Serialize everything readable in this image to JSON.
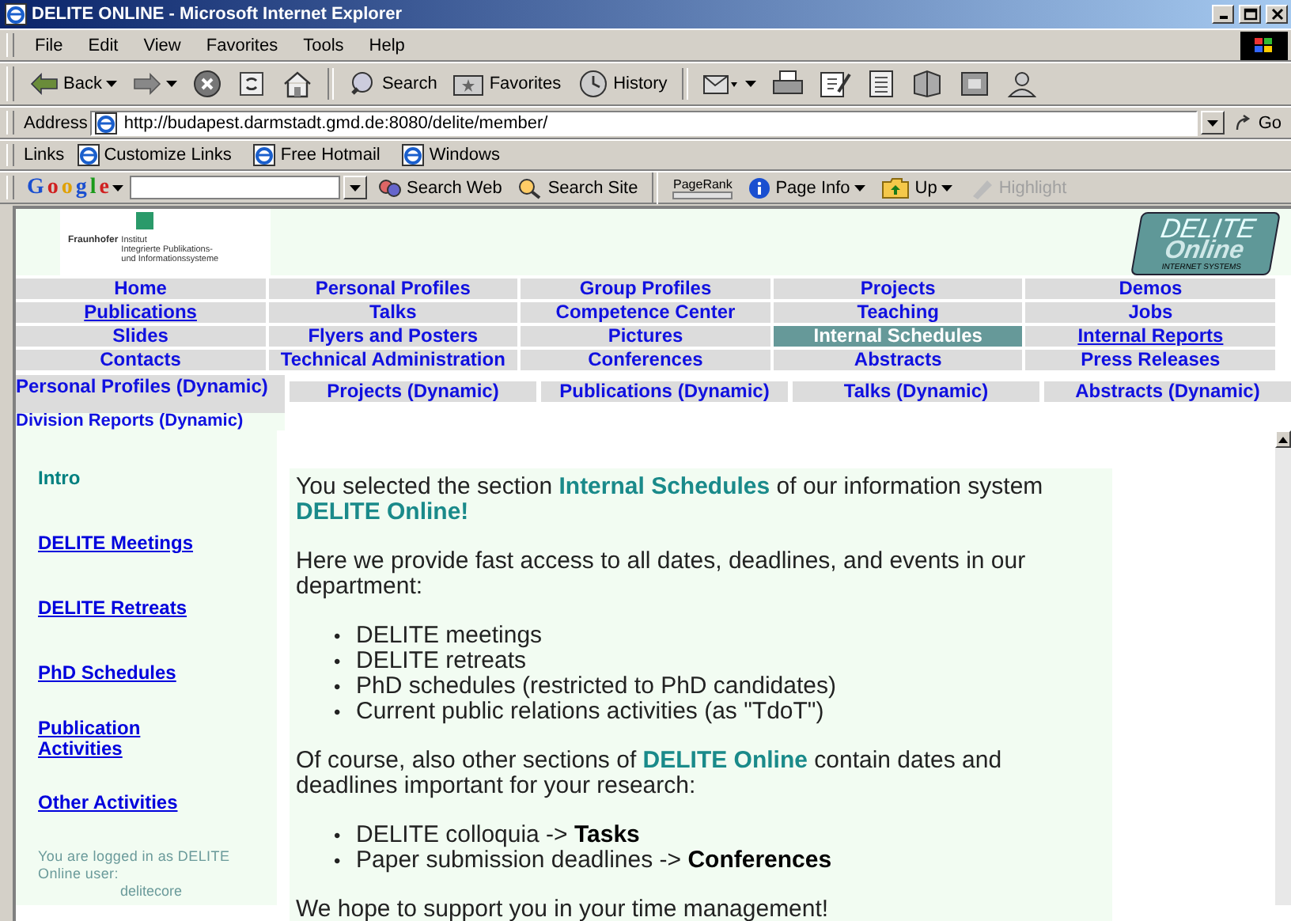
{
  "window": {
    "title": "DELITE ONLINE - Microsoft Internet Explorer"
  },
  "menu": [
    "File",
    "Edit",
    "View",
    "Favorites",
    "Tools",
    "Help"
  ],
  "toolbar": [
    {
      "kind": "back",
      "label": "Back"
    },
    {
      "kind": "forward"
    },
    {
      "kind": "stop"
    },
    {
      "kind": "refresh"
    },
    {
      "kind": "home"
    },
    {
      "kind": "search",
      "label": "Search"
    },
    {
      "kind": "favorites",
      "label": "Favorites"
    },
    {
      "kind": "history",
      "label": "History"
    },
    {
      "kind": "mail"
    },
    {
      "kind": "print"
    },
    {
      "kind": "edit"
    },
    {
      "kind": "discuss"
    },
    {
      "kind": "research"
    },
    {
      "kind": "messenger"
    },
    {
      "kind": "contacts"
    }
  ],
  "address": {
    "label": "Address",
    "value": "http://budapest.darmstadt.gmd.de:8080/delite/member/",
    "go": "Go"
  },
  "links": {
    "label": "Links",
    "items": [
      "Customize Links",
      "Free Hotmail",
      "Windows"
    ]
  },
  "google_bar": {
    "logo": "Google",
    "items": [
      {
        "kind": "search-web",
        "label": "Search Web"
      },
      {
        "kind": "search-site",
        "label": "Search Site"
      },
      {
        "kind": "pagerank",
        "label": "PageRank"
      },
      {
        "kind": "page-info",
        "label": "Page Info"
      },
      {
        "kind": "up",
        "label": "Up"
      },
      {
        "kind": "highlight",
        "label": "Highlight",
        "disabled": true
      }
    ]
  },
  "header": {
    "fraunhofer_logo": [
      "Fraunhofer",
      "Institut",
      "Integrierte Publikations-",
      "und Informationssysteme"
    ],
    "delite_logo": [
      "DELITE",
      "Online",
      "INTERNET SYSTEMS"
    ]
  },
  "nav": [
    [
      {
        "label": "Home",
        "selected": false,
        "underlined": false
      },
      {
        "label": "Personal Profiles",
        "selected": false,
        "underlined": false
      },
      {
        "label": "Group Profiles",
        "selected": false,
        "underlined": false
      },
      {
        "label": "Projects",
        "selected": false,
        "underlined": false
      },
      {
        "label": "Demos",
        "selected": false,
        "underlined": false
      }
    ],
    [
      {
        "label": "Publications",
        "selected": false,
        "underlined": true
      },
      {
        "label": "Talks",
        "selected": false,
        "underlined": false
      },
      {
        "label": "Competence Center",
        "selected": false,
        "underlined": false
      },
      {
        "label": "Teaching",
        "selected": false,
        "underlined": false
      },
      {
        "label": "Jobs",
        "selected": false,
        "underlined": false
      }
    ],
    [
      {
        "label": "Slides",
        "selected": false,
        "underlined": false
      },
      {
        "label": "Flyers and Posters",
        "selected": false,
        "underlined": false
      },
      {
        "label": "Pictures",
        "selected": false,
        "underlined": false
      },
      {
        "label": "Internal Schedules",
        "selected": true,
        "underlined": false
      },
      {
        "label": "Internal Reports",
        "selected": false,
        "underlined": true
      }
    ],
    [
      {
        "label": "Contacts",
        "selected": false,
        "underlined": false
      },
      {
        "label": "Technical Administration",
        "selected": false,
        "underlined": false
      },
      {
        "label": "Conferences",
        "selected": false,
        "underlined": false
      },
      {
        "label": "Abstracts",
        "selected": false,
        "underlined": false
      },
      {
        "label": "Press Releases",
        "selected": false,
        "underlined": false
      }
    ]
  ],
  "dynamic_nav": {
    "first": "Personal Profiles (Dynamic)",
    "items": [
      "Projects (Dynamic)",
      "Publications (Dynamic)",
      "Talks (Dynamic)",
      "Abstracts (Dynamic)"
    ],
    "below": "Division Reports (Dynamic)"
  },
  "sidebar": {
    "items": [
      {
        "label": "Intro",
        "selected": true
      },
      {
        "label": "DELITE Meetings",
        "selected": false
      },
      {
        "label": "DELITE Retreats",
        "selected": false
      },
      {
        "label": "PhD Schedules",
        "selected": false
      },
      {
        "label": "Publication Activities",
        "selected": false
      },
      {
        "label": "Other Activities",
        "selected": false
      }
    ],
    "login_note": "You are logged in as DELITE Online user:",
    "user": "delitecore"
  },
  "content": [
    {
      "kind": "paragraph",
      "text": "You selected the section **Internal Schedules** of our information system **DELITE Online!**"
    },
    {
      "kind": "paragraph",
      "text": "Here we provide fast access to all dates, deadlines, and events in our department:"
    },
    {
      "kind": "list",
      "marker": "•",
      "items": [
        "DELITE meetings",
        "DELITE retreats",
        "PhD schedules (restricted to PhD candidates)",
        "Current public relations activities (as \"TdoT\")"
      ]
    },
    {
      "kind": "paragraph",
      "text": "Of course, also other sections of **DELITE Online** contain dates and deadlines important for your research:"
    },
    {
      "kind": "list",
      "marker": "•",
      "items": [
        "DELITE colloquia -> **Tasks**",
        "Paper submission deadlines -> **Conferences**"
      ]
    },
    {
      "kind": "paragraph",
      "text": "We hope to support you in your time management!"
    }
  ]
}
